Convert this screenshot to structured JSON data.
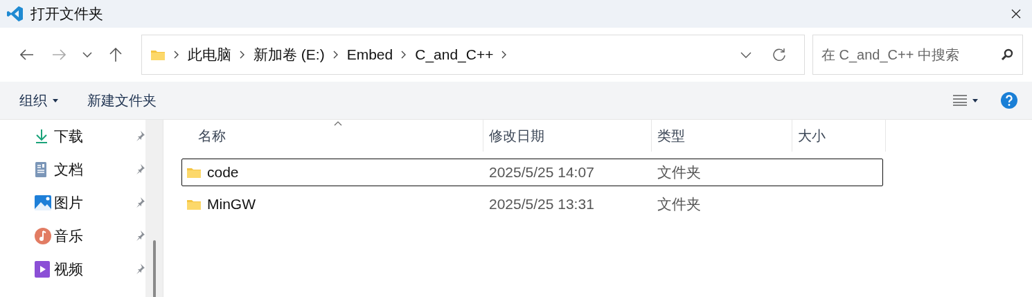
{
  "window": {
    "title": "打开文件夹"
  },
  "nav": {
    "breadcrumbs": [
      "此电脑",
      "新加卷 (E:)",
      "Embed",
      "C_and_C++"
    ],
    "search": {
      "placeholder": "在 C_and_C++ 中搜索"
    }
  },
  "toolbar": {
    "organize": "组织",
    "new_folder": "新建文件夹"
  },
  "sidebar": {
    "items": [
      {
        "label": "下载",
        "kind": "download",
        "pinned": true
      },
      {
        "label": "文档",
        "kind": "document",
        "pinned": true
      },
      {
        "label": "图片",
        "kind": "pictures",
        "pinned": true
      },
      {
        "label": "音乐",
        "kind": "music",
        "pinned": true
      },
      {
        "label": "视频",
        "kind": "video",
        "pinned": true
      }
    ]
  },
  "table": {
    "columns": [
      "名称",
      "修改日期",
      "类型",
      "大小"
    ],
    "rows": [
      {
        "name": "code",
        "modified": "2025/5/25 14:07",
        "type": "文件夹",
        "focused": true
      },
      {
        "name": "MinGW",
        "modified": "2025/5/25 13:31",
        "type": "文件夹",
        "focused": false
      }
    ]
  }
}
